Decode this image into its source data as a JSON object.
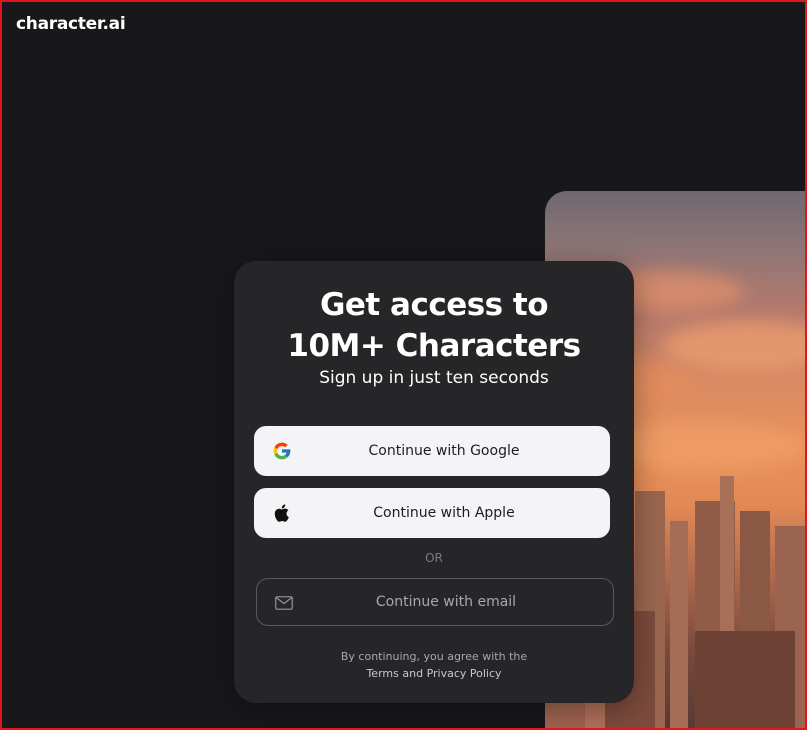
{
  "brand": {
    "logo_text": "character.ai"
  },
  "signup": {
    "headline_line1": "Get access to",
    "headline_line2": "10M+ Characters",
    "subheadline": "Sign up in just ten seconds",
    "google_label": "Continue with Google",
    "apple_label": "Continue with Apple",
    "divider_label": "OR",
    "email_label": "Continue with email",
    "legal_prefix": "By continuing, you agree with the",
    "terms_label": "Terms",
    "and_label": "and",
    "privacy_label": "Privacy Policy"
  },
  "icons": {
    "google": "google-icon",
    "apple": "apple-icon",
    "email": "mail-icon"
  },
  "colors": {
    "background": "#18171a",
    "card": "#262528",
    "button_light": "#f4f3f5",
    "frame_border": "#e3141b"
  }
}
